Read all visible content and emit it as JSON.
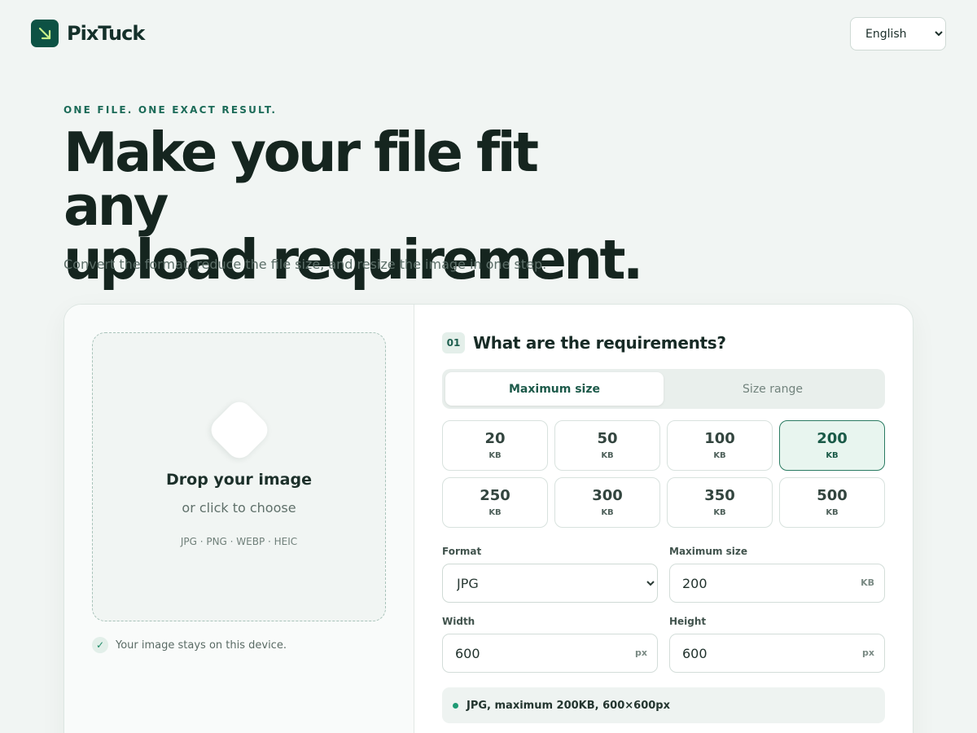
{
  "header": {
    "brand": "PixTuck",
    "language": {
      "selected": "English",
      "options": [
        "English"
      ]
    }
  },
  "hero": {
    "eyebrow": "ONE FILE. ONE EXACT RESULT.",
    "headline_line1": "Make your file fit any",
    "headline_line2": "upload requirement.",
    "subline": "Convert the format, reduce the file size, and resize the image in one step."
  },
  "upload": {
    "title": "Drop your image",
    "subtitle": "or click to choose",
    "formats": "JPG · PNG · WEBP · HEIC",
    "privacy": "Your image stays on this device.",
    "privacy_check": "✓"
  },
  "requirements": {
    "step": "01",
    "title": "What are the requirements?",
    "tabs": [
      {
        "label": "Maximum size",
        "active": true
      },
      {
        "label": "Size range",
        "active": false
      }
    ],
    "presets": [
      {
        "value": "20",
        "unit": "KB",
        "selected": false
      },
      {
        "value": "50",
        "unit": "KB",
        "selected": false
      },
      {
        "value": "100",
        "unit": "KB",
        "selected": false
      },
      {
        "value": "200",
        "unit": "KB",
        "selected": true
      },
      {
        "value": "250",
        "unit": "KB",
        "selected": false
      },
      {
        "value": "300",
        "unit": "KB",
        "selected": false
      },
      {
        "value": "350",
        "unit": "KB",
        "selected": false
      },
      {
        "value": "500",
        "unit": "KB",
        "selected": false
      }
    ],
    "format": {
      "label": "Format",
      "selected": "JPG",
      "options": [
        "JPG"
      ]
    },
    "max_size": {
      "label": "Maximum size",
      "value": "200",
      "unit": "KB"
    },
    "width": {
      "label": "Width",
      "value": "600",
      "unit": "px"
    },
    "height": {
      "label": "Height",
      "value": "600",
      "unit": "px"
    },
    "summary": "JPG, maximum 200KB, 600×600px"
  },
  "colors": {
    "brand": "#0d5244",
    "accent": "#1c6b58",
    "selected_bg": "#e8f5ef",
    "status_dot": "#1f9a74"
  }
}
